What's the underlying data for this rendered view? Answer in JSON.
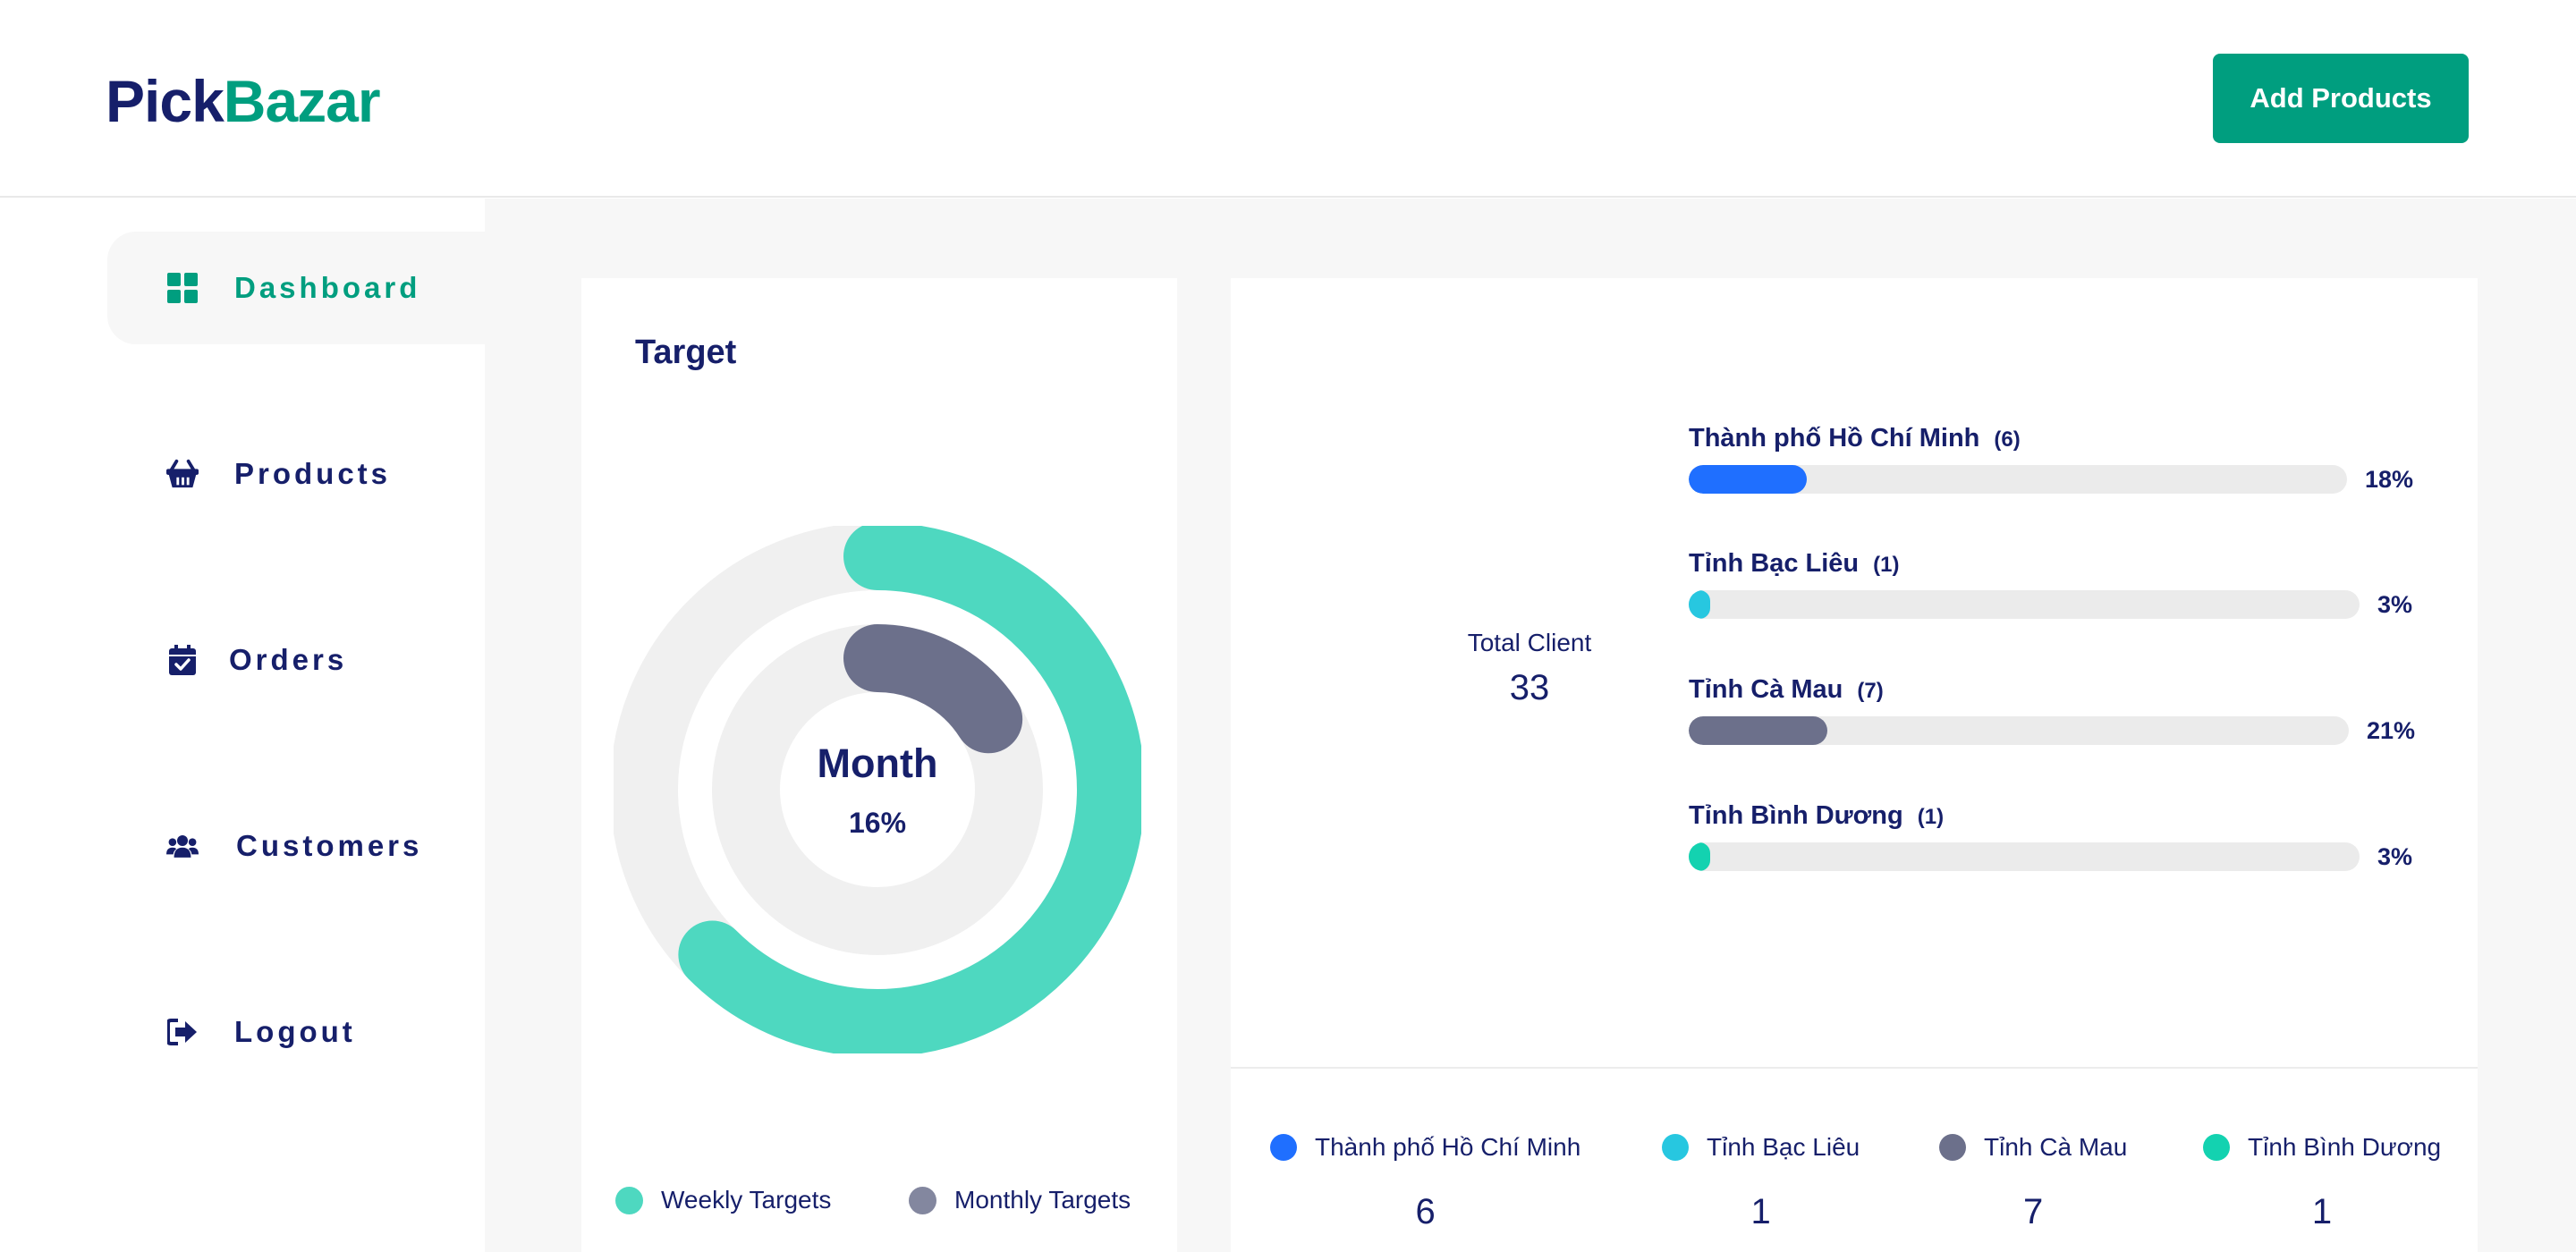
{
  "header": {
    "logo_part1": "Pick",
    "logo_part2": "Bazar",
    "add_products_label": "Add Products"
  },
  "sidebar": {
    "items": [
      {
        "label": "Dashboard",
        "icon": "dashboard-grid-icon",
        "active": true
      },
      {
        "label": "Products",
        "icon": "basket-icon",
        "active": false
      },
      {
        "label": "Orders",
        "icon": "calendar-check-icon",
        "active": false
      },
      {
        "label": "Customers",
        "icon": "users-icon",
        "active": false
      },
      {
        "label": "Logout",
        "icon": "sign-out-icon",
        "active": false
      }
    ]
  },
  "target": {
    "title": "Target",
    "center_label": "Month",
    "center_value": "16%",
    "weekly_fraction": 0.625,
    "monthly_fraction": 0.16,
    "legend": [
      {
        "label": "Weekly Targets",
        "color": "#4ed8c0"
      },
      {
        "label": "Monthly Targets",
        "color": "#83879f"
      }
    ],
    "colors": {
      "weekly": "#4ed8c0",
      "monthly": "#6c708b",
      "track": "#f0f0f0"
    }
  },
  "clients": {
    "total_label": "Total Client",
    "total_value": "33",
    "bars": [
      {
        "name": "Thành phố Hồ Chí Minh",
        "count": "(6)",
        "percent_label": "18%",
        "percent": 18,
        "color": "#1f6fff"
      },
      {
        "name": "Tỉnh Bạc Liêu",
        "count": "(1)",
        "percent_label": "3%",
        "percent": 3,
        "color": "#27c7e0"
      },
      {
        "name": "Tỉnh Cà Mau",
        "count": "(7)",
        "percent_label": "21%",
        "percent": 21,
        "color": "#6c708b"
      },
      {
        "name": "Tỉnh Bình Dương",
        "count": "(1)",
        "percent_label": "3%",
        "percent": 3,
        "color": "#13d2b0"
      }
    ],
    "stats": [
      {
        "name": "Thành phố Hồ Chí Minh",
        "value": "6",
        "color": "#1f6fff"
      },
      {
        "name": "Tỉnh Bạc Liêu",
        "value": "1",
        "color": "#27c7e0"
      },
      {
        "name": "Tỉnh Cà Mau",
        "value": "7",
        "color": "#6c708b"
      },
      {
        "name": "Tỉnh Bình Dương",
        "value": "1",
        "color": "#13d2b0"
      }
    ]
  }
}
